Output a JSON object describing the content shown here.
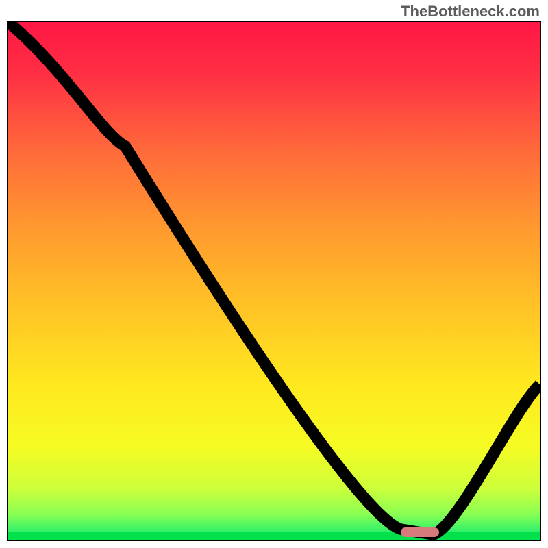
{
  "watermark": "TheBottleneck.com",
  "chart_data": {
    "type": "line",
    "title": "",
    "xlabel": "",
    "ylabel": "",
    "xlim": [
      0,
      100
    ],
    "ylim": [
      0,
      100
    ],
    "x": [
      0,
      22,
      74,
      80,
      100
    ],
    "values": [
      100,
      76,
      2,
      1,
      30
    ],
    "optimal_marker_x": 77,
    "background": "red-yellow-green vertical gradient",
    "gradient_stops": [
      {
        "pos": 0.0,
        "color": "#ff1745"
      },
      {
        "pos": 0.1,
        "color": "#ff2f44"
      },
      {
        "pos": 0.25,
        "color": "#ff6a3a"
      },
      {
        "pos": 0.4,
        "color": "#ff9a2f"
      },
      {
        "pos": 0.55,
        "color": "#ffc326"
      },
      {
        "pos": 0.7,
        "color": "#ffe81f"
      },
      {
        "pos": 0.82,
        "color": "#f6fb23"
      },
      {
        "pos": 0.9,
        "color": "#ceff3a"
      },
      {
        "pos": 0.95,
        "color": "#8bff53"
      },
      {
        "pos": 0.985,
        "color": "#2ef06a"
      },
      {
        "pos": 1.0,
        "color": "#02e14b"
      }
    ]
  }
}
